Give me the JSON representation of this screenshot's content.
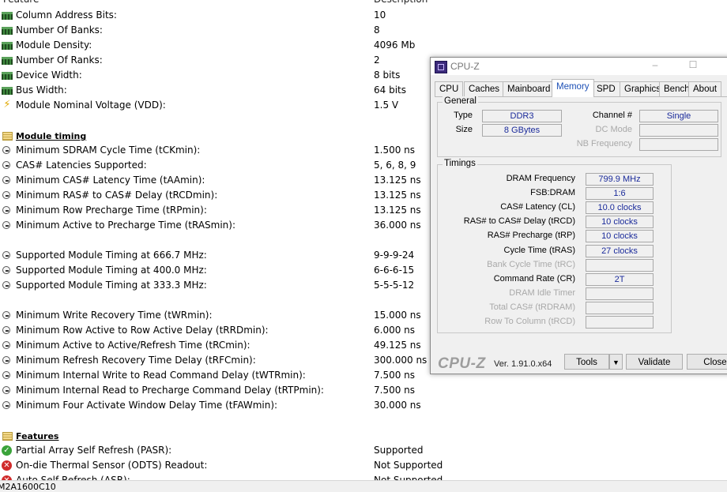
{
  "report": {
    "header": {
      "feature": "Feature",
      "description": "Description"
    },
    "general_rows": [
      {
        "icon": "ram-module-icon",
        "label": "Column Address Bits:",
        "value": "10"
      },
      {
        "icon": "ram-module-icon",
        "label": "Number Of Banks:",
        "value": "8"
      },
      {
        "icon": "ram-module-icon",
        "label": "Module Density:",
        "value": "4096 Mb"
      },
      {
        "icon": "ram-module-icon",
        "label": "Number Of Ranks:",
        "value": "2"
      },
      {
        "icon": "ram-module-icon",
        "label": "Device Width:",
        "value": "8 bits"
      },
      {
        "icon": "ram-module-icon",
        "label": "Bus Width:",
        "value": "64 bits"
      },
      {
        "icon": "lightning-bolt-icon",
        "label": "Module Nominal Voltage (VDD):",
        "value": "1.5 V"
      }
    ],
    "timing_section": "Module timing",
    "timing_rows": [
      {
        "label": "Minimum SDRAM Cycle Time (tCKmin):",
        "value": "1.500 ns"
      },
      {
        "label": "CAS# Latencies Supported:",
        "value": "5, 6, 8, 9"
      },
      {
        "label": "Minimum CAS# Latency Time (tAAmin):",
        "value": "13.125 ns"
      },
      {
        "label": "Minimum RAS# to CAS# Delay (tRCDmin):",
        "value": "13.125 ns"
      },
      {
        "label": "Minimum Row Precharge Time (tRPmin):",
        "value": "13.125 ns"
      },
      {
        "label": "Minimum Active to Precharge Time (tRASmin):",
        "value": "36.000 ns"
      }
    ],
    "supported_rows": [
      {
        "label": "Supported Module Timing at 666.7 MHz:",
        "value": "9-9-9-24"
      },
      {
        "label": "Supported Module Timing at 400.0 MHz:",
        "value": "6-6-6-15"
      },
      {
        "label": "Supported Module Timing at 333.3 MHz:",
        "value": "5-5-5-12"
      }
    ],
    "extra_timing_rows": [
      {
        "label": "Minimum Write Recovery Time (tWRmin):",
        "value": "15.000 ns"
      },
      {
        "label": "Minimum Row Active to Row Active Delay (tRRDmin):",
        "value": "6.000 ns"
      },
      {
        "label": "Minimum Active to Active/Refresh Time (tRCmin):",
        "value": "49.125 ns"
      },
      {
        "label": "Minimum Refresh Recovery Time Delay (tRFCmin):",
        "value": "300.000 ns"
      },
      {
        "label": "Minimum Internal Write to Read Command Delay (tWTRmin):",
        "value": "7.500 ns"
      },
      {
        "label": "Minimum Internal Read to Precharge Command Delay (tRTPmin):",
        "value": "7.500 ns"
      },
      {
        "label": "Minimum Four Activate Window Delay Time (tFAWmin):",
        "value": "30.000 ns"
      }
    ],
    "features_section": "Features",
    "feature_rows": [
      {
        "icon": "check-icon",
        "label": "Partial Array Self Refresh (PASR):",
        "value": "Supported"
      },
      {
        "icon": "cross-icon",
        "label": "On-die Thermal Sensor (ODTS) Readout:",
        "value": "Not Supported"
      },
      {
        "icon": "cross-icon",
        "label": "Auto Self Refresh (ASR):",
        "value": "Not Supported"
      }
    ],
    "status_text": "M2A1600C10"
  },
  "cpuz": {
    "title": "CPU-Z",
    "tabs": [
      "CPU",
      "Caches",
      "Mainboard",
      "Memory",
      "SPD",
      "Graphics",
      "Bench",
      "About"
    ],
    "active_tab": "Memory",
    "general": {
      "title": "General",
      "type_label": "Type",
      "type_value": "DDR3",
      "size_label": "Size",
      "size_value": "8 GBytes",
      "channel_label": "Channel #",
      "channel_value": "Single",
      "dc_mode_label": "DC Mode",
      "dc_mode_value": "",
      "nb_freq_label": "NB Frequency",
      "nb_freq_value": ""
    },
    "timings": {
      "title": "Timings",
      "rows": [
        {
          "label": "DRAM Frequency",
          "value": "799.9 MHz",
          "enabled": true
        },
        {
          "label": "FSB:DRAM",
          "value": "1:6",
          "enabled": true
        },
        {
          "label": "CAS# Latency (CL)",
          "value": "10.0 clocks",
          "enabled": true
        },
        {
          "label": "RAS# to CAS# Delay (tRCD)",
          "value": "10 clocks",
          "enabled": true
        },
        {
          "label": "RAS# Precharge (tRP)",
          "value": "10 clocks",
          "enabled": true
        },
        {
          "label": "Cycle Time (tRAS)",
          "value": "27 clocks",
          "enabled": true
        },
        {
          "label": "Bank Cycle Time (tRC)",
          "value": "",
          "enabled": false
        },
        {
          "label": "Command Rate (CR)",
          "value": "2T",
          "enabled": true
        },
        {
          "label": "DRAM Idle Timer",
          "value": "",
          "enabled": false
        },
        {
          "label": "Total CAS# (tRDRAM)",
          "value": "",
          "enabled": false
        },
        {
          "label": "Row To Column (tRCD)",
          "value": "",
          "enabled": false
        }
      ]
    },
    "brand": "CPU-Z",
    "version": "Ver. 1.91.0.x64",
    "buttons": {
      "tools": "Tools",
      "validate": "Validate",
      "close": "Close"
    }
  }
}
